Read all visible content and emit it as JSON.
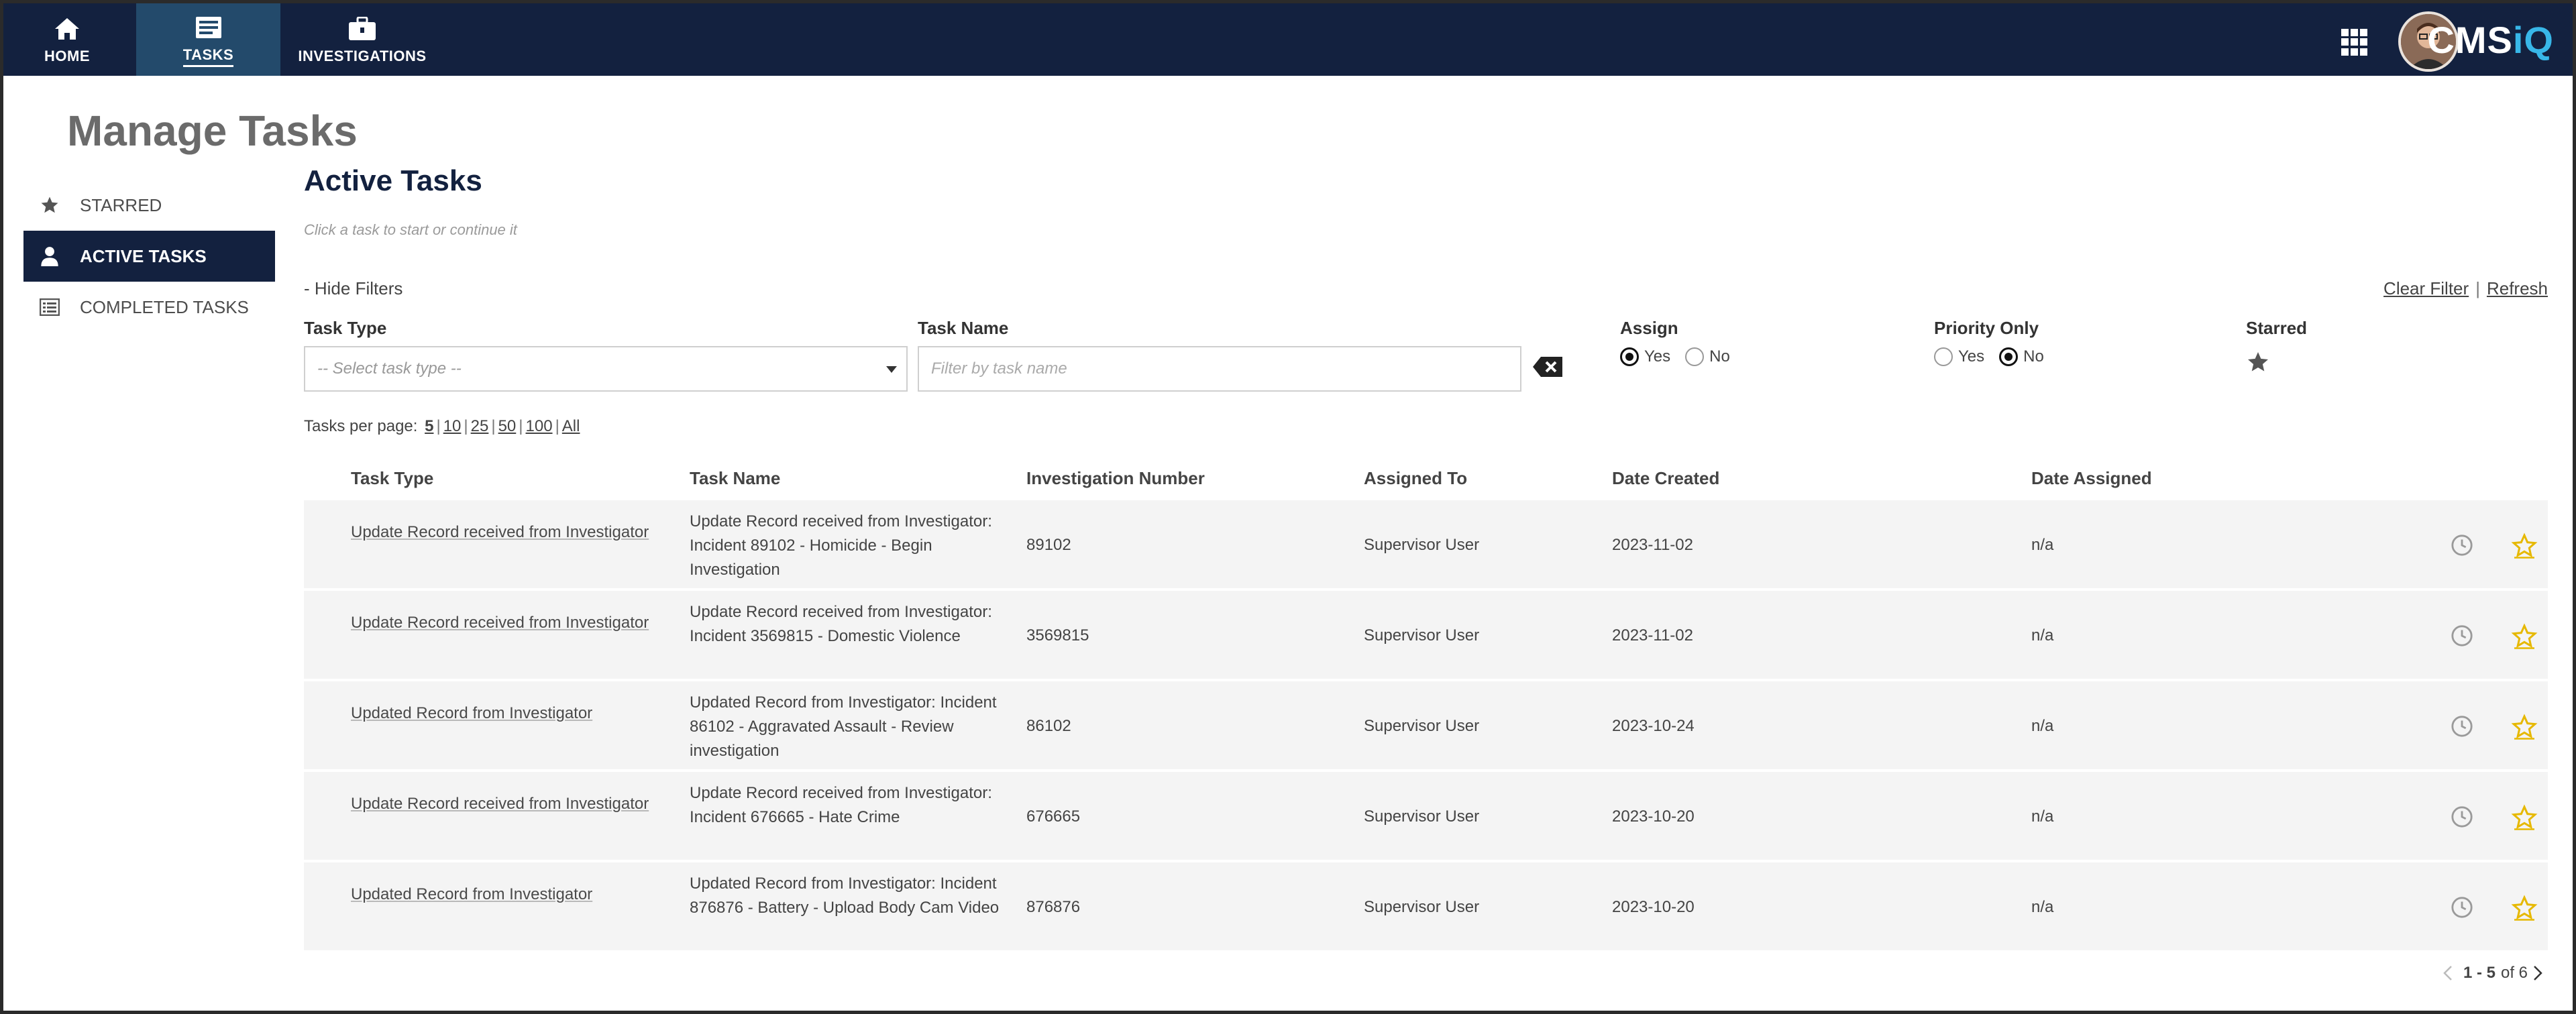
{
  "topnav": {
    "items": [
      {
        "label": "HOME",
        "icon": "home-icon"
      },
      {
        "label": "TASKS",
        "icon": "tasks-icon",
        "active": true
      },
      {
        "label": "INVESTIGATIONS",
        "icon": "briefcase-icon"
      }
    ],
    "brand_main": "CMS",
    "brand_accent": "iQ",
    "colors": {
      "nav_bg": "#13213f",
      "active_bg": "#234a6b",
      "brand_accent": "#38b7e8"
    }
  },
  "page_title": "Manage Tasks",
  "sidebar": {
    "items": [
      {
        "label": "STARRED",
        "icon": "star-icon"
      },
      {
        "label": "ACTIVE TASKS",
        "icon": "user-icon",
        "active": true
      },
      {
        "label": "COMPLETED TASKS",
        "icon": "list-icon"
      }
    ]
  },
  "main": {
    "title": "Active Tasks",
    "subtitle": "Click a task to start or continue it",
    "hide_filters": "- Hide Filters",
    "clear_filter": "Clear Filter",
    "refresh": "Refresh",
    "filters": {
      "task_type_label": "Task Type",
      "task_type_value": "-- Select task type --",
      "task_name_label": "Task Name",
      "task_name_placeholder": "Filter by task name",
      "assign_label": "Assign",
      "assign_yes": "Yes",
      "assign_no": "No",
      "assign_selected": "Yes",
      "priority_label": "Priority Only",
      "priority_yes": "Yes",
      "priority_no": "No",
      "priority_selected": "No",
      "starred_label": "Starred"
    },
    "per_page": {
      "label": "Tasks per page:",
      "options": [
        "5",
        "10",
        "25",
        "50",
        "100",
        "All"
      ],
      "selected": "5"
    },
    "table": {
      "columns": [
        "Task Type",
        "Task Name",
        "Investigation Number",
        "Assigned To",
        "Date Created",
        "Date Assigned"
      ],
      "rows": [
        {
          "task_type": "Update Record received from Investigator",
          "task_name": "Update Record received from Investigator: Incident 89102 - Homicide - Begin Investigation",
          "investigation_number": "89102",
          "assigned_to": "Supervisor User",
          "date_created": "2023-11-02",
          "date_assigned": "n/a"
        },
        {
          "task_type": "Update Record received from Investigator",
          "task_name": "Update Record received from Investigator: Incident 3569815 - Domestic Violence",
          "investigation_number": "3569815",
          "assigned_to": "Supervisor User",
          "date_created": "2023-11-02",
          "date_assigned": "n/a"
        },
        {
          "task_type": "Updated Record from Investigator",
          "task_name": "Updated Record from Investigator: Incident 86102 - Aggravated Assault - Review investigation",
          "investigation_number": "86102",
          "assigned_to": "Supervisor User",
          "date_created": "2023-10-24",
          "date_assigned": "n/a"
        },
        {
          "task_type": "Update Record received from Investigator",
          "task_name": "Update Record received from Investigator: Incident 676665 - Hate Crime",
          "investigation_number": "676665",
          "assigned_to": "Supervisor User",
          "date_created": "2023-10-20",
          "date_assigned": "n/a"
        },
        {
          "task_type": "Updated Record from Investigator",
          "task_name": "Updated Record from Investigator: Incident 876876 - Battery - Upload Body Cam Video",
          "investigation_number": "876876",
          "assigned_to": "Supervisor User",
          "date_created": "2023-10-20",
          "date_assigned": "n/a"
        }
      ]
    },
    "pager": {
      "range": "1 - 5",
      "of_text": "of 6"
    }
  }
}
